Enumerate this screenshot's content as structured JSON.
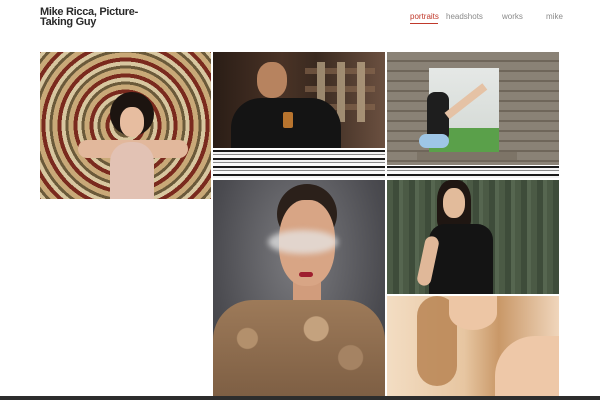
{
  "site": {
    "title": "Mike Ricca, Picture-Taking Guy"
  },
  "nav": {
    "items": [
      {
        "label": "portraits",
        "active": true
      },
      {
        "label": "headshots",
        "active": false
      },
      {
        "label": "works",
        "active": false
      },
      {
        "label": "mike",
        "active": false
      }
    ]
  },
  "colors": {
    "accent": "#c0392b",
    "nav_text": "#8a8a8a",
    "title_text": "#2a2a2a"
  },
  "gallery": {
    "photos": [
      {
        "name": "woman-on-rug-photo"
      },
      {
        "name": "man-with-drink-photo"
      },
      {
        "name": "woman-in-window-photo"
      },
      {
        "name": "smoke-portrait-photo"
      },
      {
        "name": "woman-black-tee-photo"
      },
      {
        "name": "blonde-closeup-photo"
      }
    ]
  }
}
